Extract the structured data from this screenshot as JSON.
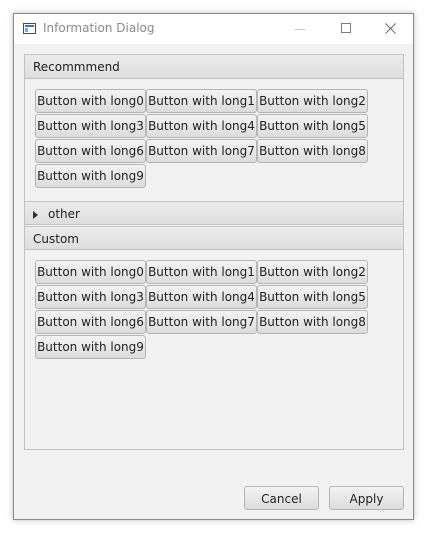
{
  "window": {
    "title": "Information Dialog",
    "controls": {
      "minimize": "minimize",
      "maximize": "maximize",
      "close": "close"
    }
  },
  "panes": [
    {
      "title": "Recommmend",
      "expanded": true,
      "buttons": [
        "Button with long0",
        "Button with long1",
        "Button with long2",
        "Button with long3",
        "Button with long4",
        "Button with long5",
        "Button with long6",
        "Button with long7",
        "Button with long8",
        "Button with long9"
      ]
    },
    {
      "title": "other",
      "expanded": false
    },
    {
      "title": "Custom",
      "expanded": true,
      "buttons": [
        "Button with long0",
        "Button with long1",
        "Button with long2",
        "Button with long3",
        "Button with long4",
        "Button with long5",
        "Button with long6",
        "Button with long7",
        "Button with long8",
        "Button with long9"
      ]
    }
  ],
  "footer": {
    "cancel_label": "Cancel",
    "apply_label": "Apply"
  },
  "icons": {
    "app": "window-app-icon",
    "expand": "triangle-right-icon"
  }
}
